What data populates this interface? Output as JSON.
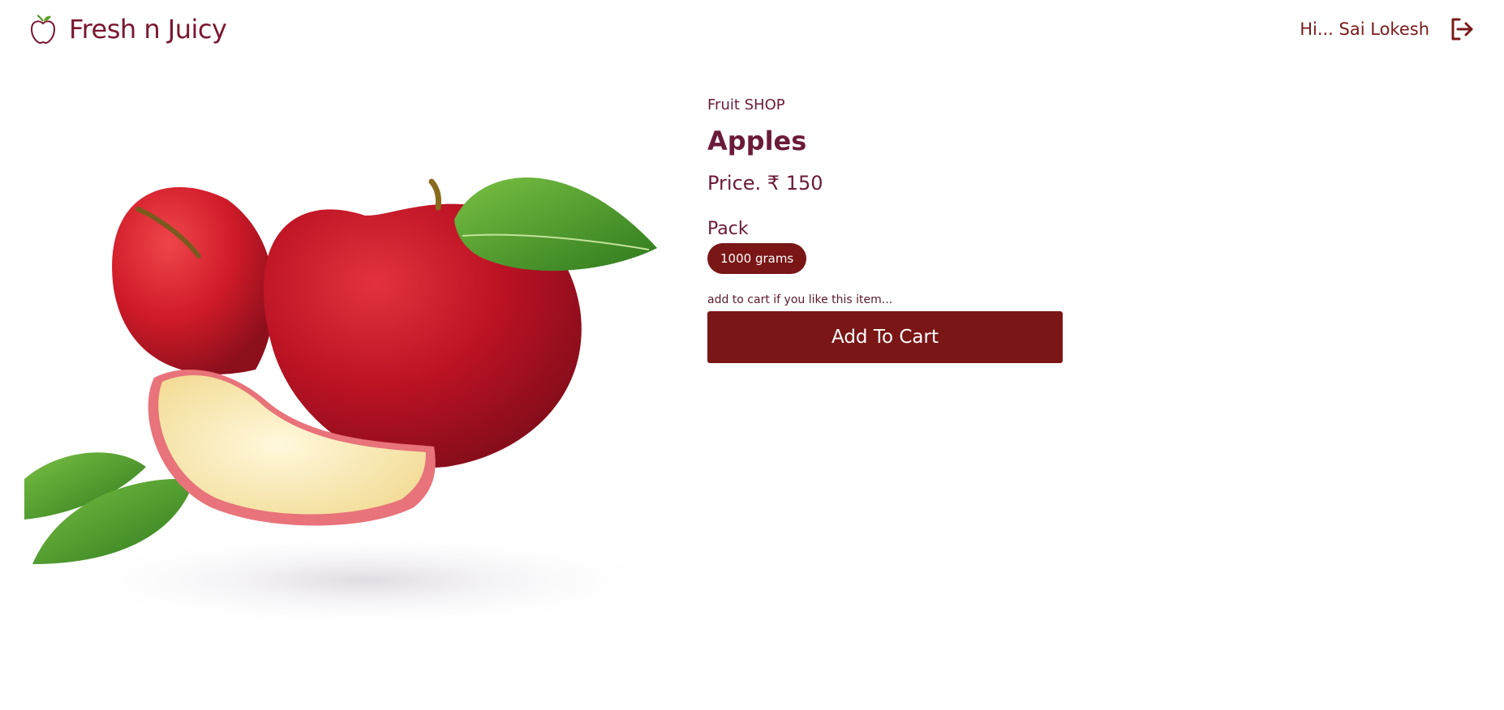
{
  "header": {
    "brand_name": "Fresh n Juicy",
    "logo_icon": "apple-logo-icon",
    "greeting": "Hi... Sai Lokesh",
    "logout_icon": "logout-icon"
  },
  "product": {
    "shop_label": "Fruit SHOP",
    "name": "Apples",
    "price": "Price. ₹ 150",
    "pack_label": "Pack",
    "pack_options": [
      "1000 grams"
    ],
    "cart_hint": "add to cart if you like this item...",
    "add_to_cart_label": "Add To Cart",
    "image_alt": "apples-product-image"
  },
  "colors": {
    "brand": "#7a1630",
    "primary_button": "#7a1616",
    "text": "#6b1a3a",
    "background": "#ffffff"
  }
}
